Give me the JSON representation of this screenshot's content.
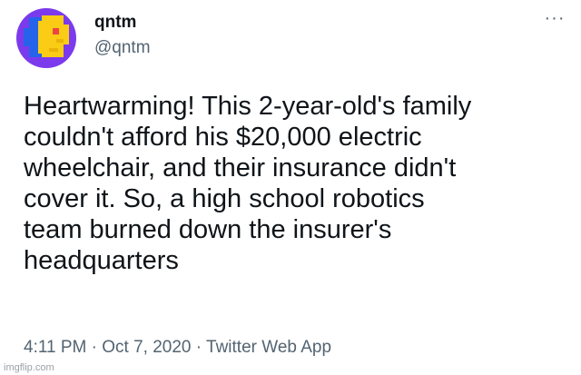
{
  "author": {
    "display_name": "qntm",
    "handle": "@qntm",
    "avatar_icon": "pixel-face-avatar-icon"
  },
  "more_icon": "more-options-icon",
  "tweet": {
    "lines": [
      "Heartwarming! This 2-year-old's family",
      "couldn't afford his $20,000 electric",
      "wheelchair, and their insurance didn't",
      "cover it. So, a high school robotics",
      "team burned down the insurer's",
      "headquarters"
    ]
  },
  "meta": {
    "time": "4:11 PM",
    "separator": " · ",
    "date": "Oct 7, 2020",
    "source": "Twitter Web App"
  },
  "watermark": "imgflip.com",
  "colors": {
    "avatar_bg": "#7c3aed",
    "avatar_yellow": "#facc15",
    "avatar_blue": "#2563eb",
    "avatar_red": "#ef4444"
  }
}
